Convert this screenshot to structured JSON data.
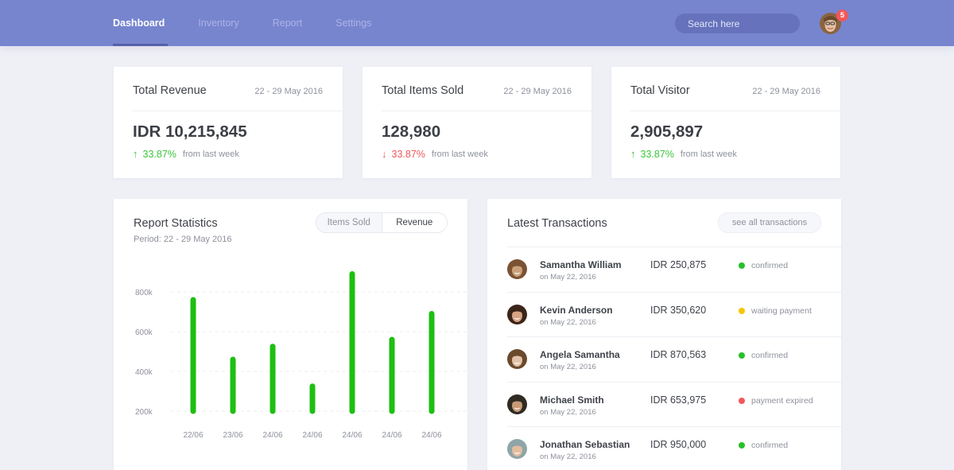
{
  "nav": {
    "items": [
      {
        "label": "Dashboard",
        "active": true
      },
      {
        "label": "Inventory",
        "active": false
      },
      {
        "label": "Report",
        "active": false
      },
      {
        "label": "Settings",
        "active": false
      }
    ],
    "search_placeholder": "Search here",
    "notification_count": "5",
    "avatar": "user-avatar"
  },
  "stats": [
    {
      "title": "Total Revenue",
      "date": "22 - 29 May 2016",
      "value": "IDR 10,215,845",
      "direction": "up",
      "arrow": "↑",
      "change": "33.87%",
      "from": "from last week"
    },
    {
      "title": "Total Items Sold",
      "date": "22 - 29 May 2016",
      "value": "128,980",
      "direction": "down",
      "arrow": "↓",
      "change": "33.87%",
      "from": "from last week"
    },
    {
      "title": "Total Visitor",
      "date": "22 - 29 May 2016",
      "value": "2,905,897",
      "direction": "up",
      "arrow": "↑",
      "change": "33.87%",
      "from": "from last week"
    }
  ],
  "report": {
    "title": "Report Statistics",
    "period": "Period: 22 - 29 May 2016",
    "toggle": {
      "items_sold": "Items Sold",
      "revenue": "Revenue",
      "selected": "Revenue"
    }
  },
  "chart_data": {
    "type": "bar",
    "title": "Report Statistics",
    "xlabel": "",
    "ylabel": "",
    "categories": [
      "22/06",
      "23/06",
      "24/06",
      "24/06",
      "24/06",
      "24/06",
      "24/06"
    ],
    "values": [
      760000,
      460000,
      525000,
      325000,
      890000,
      560000,
      690000
    ],
    "baseline": 200000,
    "ylim": [
      200000,
      900000
    ],
    "yticks": [
      200000,
      400000,
      600000,
      800000
    ],
    "ytick_labels": [
      "200k",
      "400k",
      "600k",
      "800k"
    ],
    "grid": true,
    "color": "#1dbf11"
  },
  "transactions": {
    "title": "Latest Transactions",
    "see_all": "see all transactions",
    "rows": [
      {
        "name": "Samantha William",
        "date": "on May 22, 2016",
        "amount": "IDR 250,875",
        "status": "confirmed",
        "status_color": "#27c02a",
        "avatar_color": "#c9a27a",
        "hair": "#7a5234"
      },
      {
        "name": "Kevin Anderson",
        "date": "on May 22, 2016",
        "amount": "IDR 350,620",
        "status": "waiting payment",
        "status_color": "#f7c500",
        "avatar_color": "#d6a384",
        "hair": "#3b2418"
      },
      {
        "name": "Angela Samantha",
        "date": "on May 22, 2016",
        "amount": "IDR 870,563",
        "status": "confirmed",
        "status_color": "#27c02a",
        "avatar_color": "#e2c2a8",
        "hair": "#6b4a2c"
      },
      {
        "name": "Michael Smith",
        "date": "on May 22, 2016",
        "amount": "IDR 653,975",
        "status": "payment expired",
        "status_color": "#f2575b",
        "avatar_color": "#c79a76",
        "hair": "#2f2a22"
      },
      {
        "name": "Jonathan Sebastian",
        "date": "on May 22, 2016",
        "amount": "IDR 950,000",
        "status": "confirmed",
        "status_color": "#27c02a",
        "avatar_color": "#e3bda0",
        "hair": "#8fa5a8"
      }
    ]
  }
}
